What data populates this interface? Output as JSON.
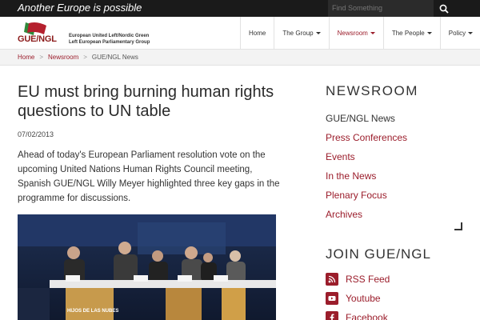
{
  "topbar": {
    "tagline": "Another Europe is possible",
    "search_placeholder": "Find Something"
  },
  "header": {
    "logo_text": "GUE/NGL",
    "logo_sub": "European United Left/Nordic Green Left European Parliamentary Group",
    "nav": [
      {
        "label": "Home",
        "dropdown": false,
        "active": false
      },
      {
        "label": "The Group",
        "dropdown": true,
        "active": false
      },
      {
        "label": "Newsroom",
        "dropdown": true,
        "active": true
      },
      {
        "label": "The People",
        "dropdown": true,
        "active": false
      },
      {
        "label": "Policy",
        "dropdown": true,
        "active": false
      }
    ]
  },
  "breadcrumb": {
    "items": [
      "Home",
      "Newsroom",
      "GUE/NGL News"
    ],
    "separator": ">"
  },
  "article": {
    "title": "EU must bring burning human rights questions to UN table",
    "date": "07/02/2013",
    "lead": "Ahead of today's European Parliament resolution vote on the upcoming United Nations Human Rights Council meeting, Spanish GUE/NGL Willy Meyer highlighted three key gaps in the programme for discussions.",
    "photo_poster_text": "HIJOS DE LAS NUBES"
  },
  "sidebar": {
    "heading": "NEWSROOM",
    "items": [
      "GUE/NGL News",
      "Press Conferences",
      "Events",
      "In the News",
      "Plenary Focus",
      "Archives"
    ],
    "join_heading": "JOIN GUE/NGL",
    "social": [
      {
        "label": "RSS Feed",
        "icon": "rss-icon"
      },
      {
        "label": "Youtube",
        "icon": "youtube-icon"
      },
      {
        "label": "Facebook",
        "icon": "facebook-icon"
      }
    ]
  },
  "colors": {
    "accent": "#9b1d2b",
    "topbar": "#1a1a1a",
    "breadcrumb_bg": "#f3f3f3"
  }
}
